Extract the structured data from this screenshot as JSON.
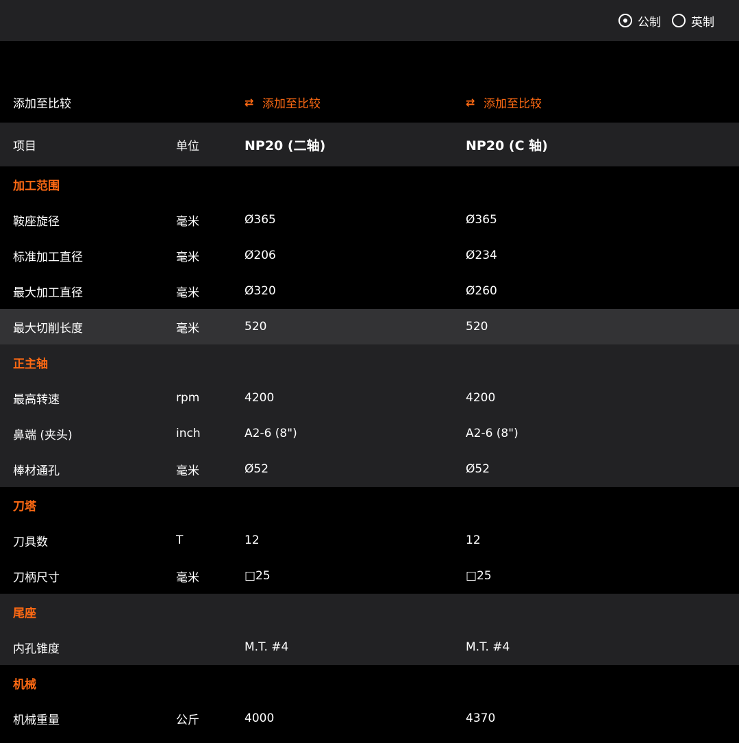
{
  "units": {
    "metric": "公制",
    "imperial": "英制",
    "selected": "metric"
  },
  "compare": {
    "row_label": "添加至比较",
    "link_label": "添加至比较"
  },
  "header": {
    "item": "项目",
    "unit": "单位",
    "models": [
      "NP20 (二轴)",
      "NP20 (C 轴)"
    ]
  },
  "sections": [
    {
      "title": "加工范围",
      "rows": [
        {
          "label": "鞍座旋径",
          "unit": "毫米",
          "values": [
            "Ø365",
            "Ø365"
          ]
        },
        {
          "label": "标准加工直径",
          "unit": "毫米",
          "values": [
            "Ø206",
            "Ø234"
          ]
        },
        {
          "label": "最大加工直径",
          "unit": "毫米",
          "values": [
            "Ø320",
            "Ø260"
          ]
        },
        {
          "label": "最大切削长度",
          "unit": "毫米",
          "values": [
            "520",
            "520"
          ]
        }
      ]
    },
    {
      "title": "正主轴",
      "rows": [
        {
          "label": "最高转速",
          "unit": "rpm",
          "values": [
            "4200",
            "4200"
          ]
        },
        {
          "label": "鼻端 (夹头)",
          "unit": "inch",
          "values": [
            "A2-6 (8\")",
            "A2-6 (8\")"
          ]
        },
        {
          "label": "棒材通孔",
          "unit": "毫米",
          "values": [
            "Ø52",
            "Ø52"
          ]
        }
      ]
    },
    {
      "title": "刀塔",
      "rows": [
        {
          "label": "刀具数",
          "unit": "T",
          "values": [
            "12",
            "12"
          ]
        },
        {
          "label": "刀柄尺寸",
          "unit": "毫米",
          "values": [
            "□25",
            "□25"
          ]
        }
      ]
    },
    {
      "title": "尾座",
      "rows": [
        {
          "label": "内孔锥度",
          "unit": "",
          "values": [
            "M.T. #4",
            "M.T. #4"
          ]
        }
      ]
    },
    {
      "title": "机械",
      "rows": [
        {
          "label": "机械重量",
          "unit": "公斤",
          "values": [
            "4000",
            "4370"
          ]
        }
      ]
    }
  ],
  "colors": {
    "accent": "#ff6a13",
    "background": "#000000",
    "band": "#222224",
    "row_highlight": "#333335"
  }
}
